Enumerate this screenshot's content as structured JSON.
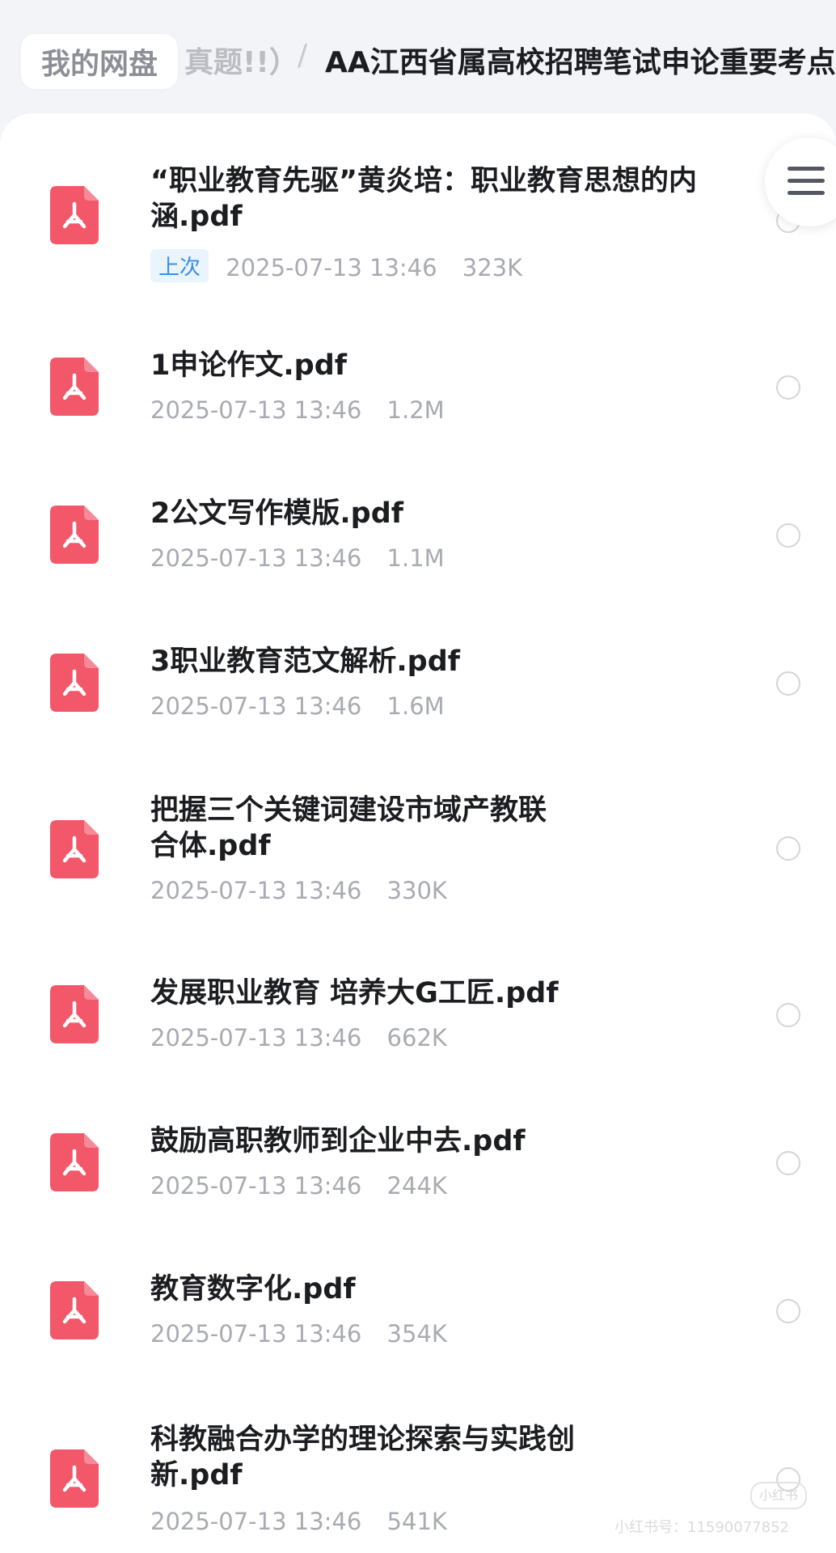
{
  "breadcrumb": {
    "home": "我的网盘",
    "middle": "真题!!）",
    "separator": "/",
    "current": "AA江西省属高校招聘笔试申论重要考点"
  },
  "menu_icon": "hamburger-menu-icon",
  "file_icon": "pdf-icon",
  "files": [
    {
      "name": "“职业教育先驱”黄炎培：职业教育思想的内涵.pdf",
      "badge": "上次",
      "date": "2025-07-13 13:46",
      "size": "323K"
    },
    {
      "name": "1申论作文.pdf",
      "date": "2025-07-13 13:46",
      "size": "1.2M"
    },
    {
      "name": "2公文写作模版.pdf",
      "date": "2025-07-13 13:46",
      "size": "1.1M"
    },
    {
      "name": "3职业教育范文解析.pdf",
      "date": "2025-07-13 13:46",
      "size": "1.6M"
    },
    {
      "name": "把握三个关键词建设市域产教联合体.pdf",
      "date": "2025-07-13 13:46",
      "size": "330K"
    },
    {
      "name": "发展职业教育 培养大G工匠.pdf",
      "date": "2025-07-13 13:46",
      "size": "662K"
    },
    {
      "name": "鼓励高职教师到企业中去.pdf",
      "date": "2025-07-13 13:46",
      "size": "244K"
    },
    {
      "name": "教育数字化.pdf",
      "date": "2025-07-13 13:46",
      "size": "354K"
    },
    {
      "name": "科教融合办学的理论探索与实践创新.pdf",
      "date": "2025-07-13 13:46",
      "size": "541K"
    }
  ],
  "watermark": {
    "logo": "小红书",
    "text": "小红书号：11590077852"
  },
  "colors": {
    "pdf_red": "#f2576a",
    "badge_blue": "#3b8ee6"
  }
}
